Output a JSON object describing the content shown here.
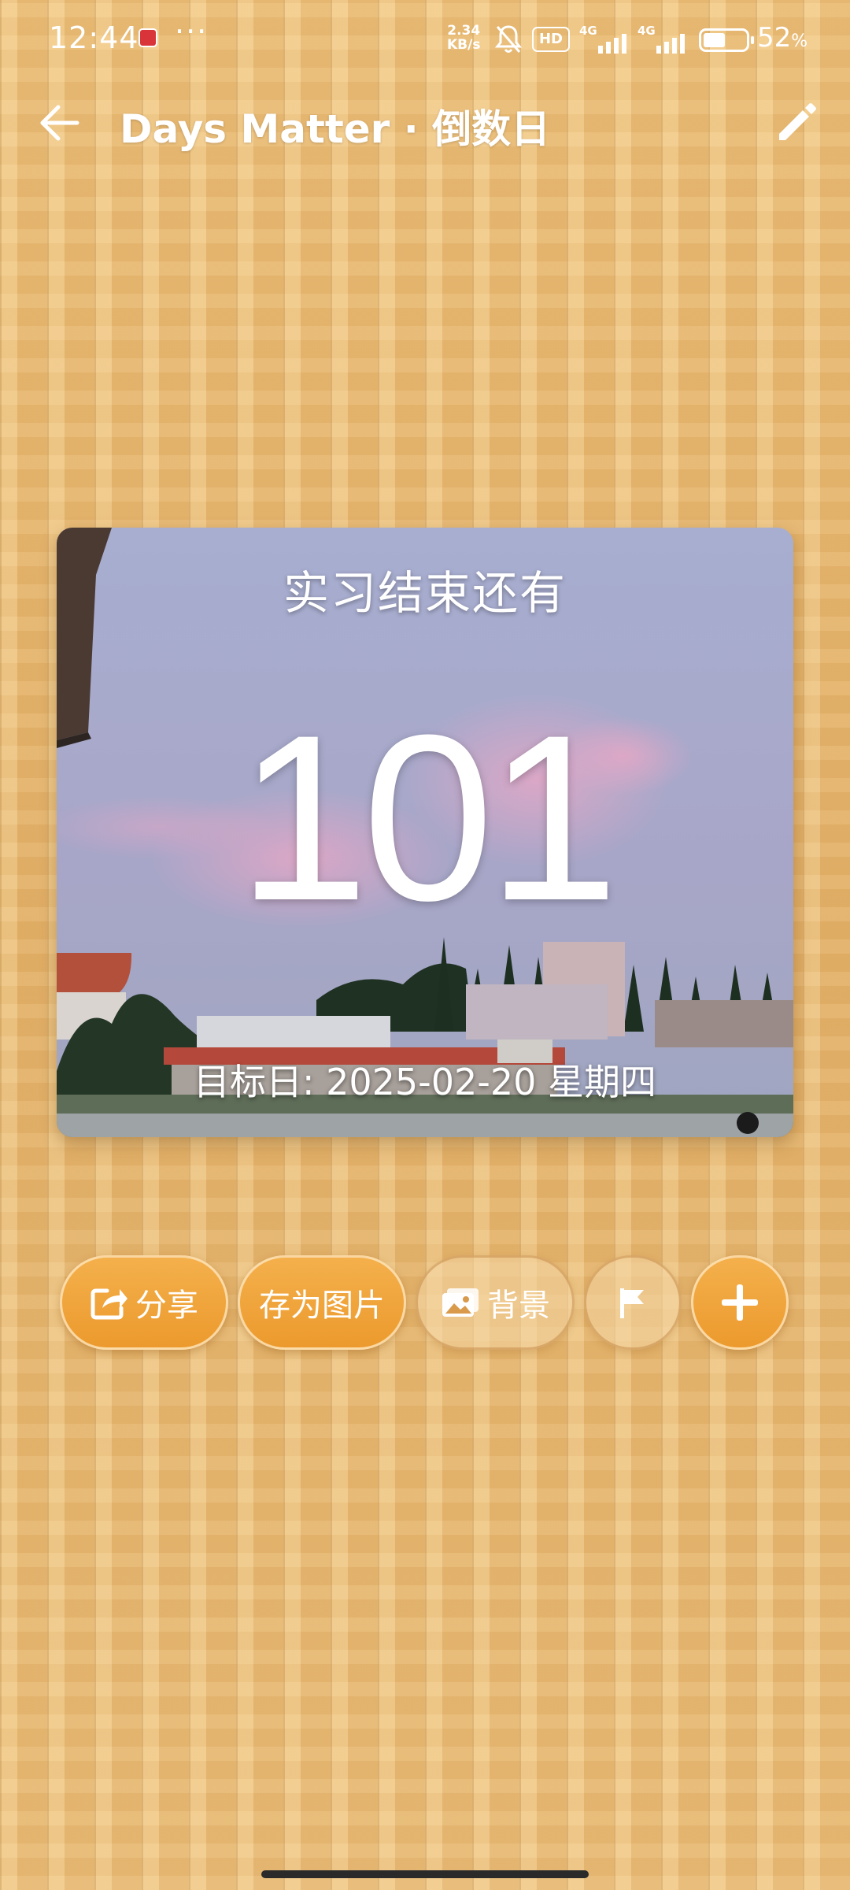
{
  "status_bar": {
    "time": "12:44",
    "more": "···",
    "net_speed_value": "2.34",
    "net_speed_unit": "KB/s",
    "hd_label": "HD",
    "signal1_label": "4G",
    "signal2_label": "4G",
    "battery_percent": "52",
    "battery_unit": "%",
    "battery_level": 0.52
  },
  "app_bar": {
    "title": "Days Matter · 倒数日",
    "back_icon": "back-arrow-icon",
    "edit_icon": "pencil-icon"
  },
  "card": {
    "title": "实习结束还有",
    "days": "101",
    "target": "目标日: 2025-02-20 星期四"
  },
  "actions": {
    "share_label": "分享",
    "save_image_label": "存为图片",
    "background_label": "背景",
    "flag_icon": "flag-icon",
    "add_icon": "plus-icon"
  },
  "colors": {
    "button_orange": "#ec9a2d",
    "wood": "#e8bb72"
  }
}
